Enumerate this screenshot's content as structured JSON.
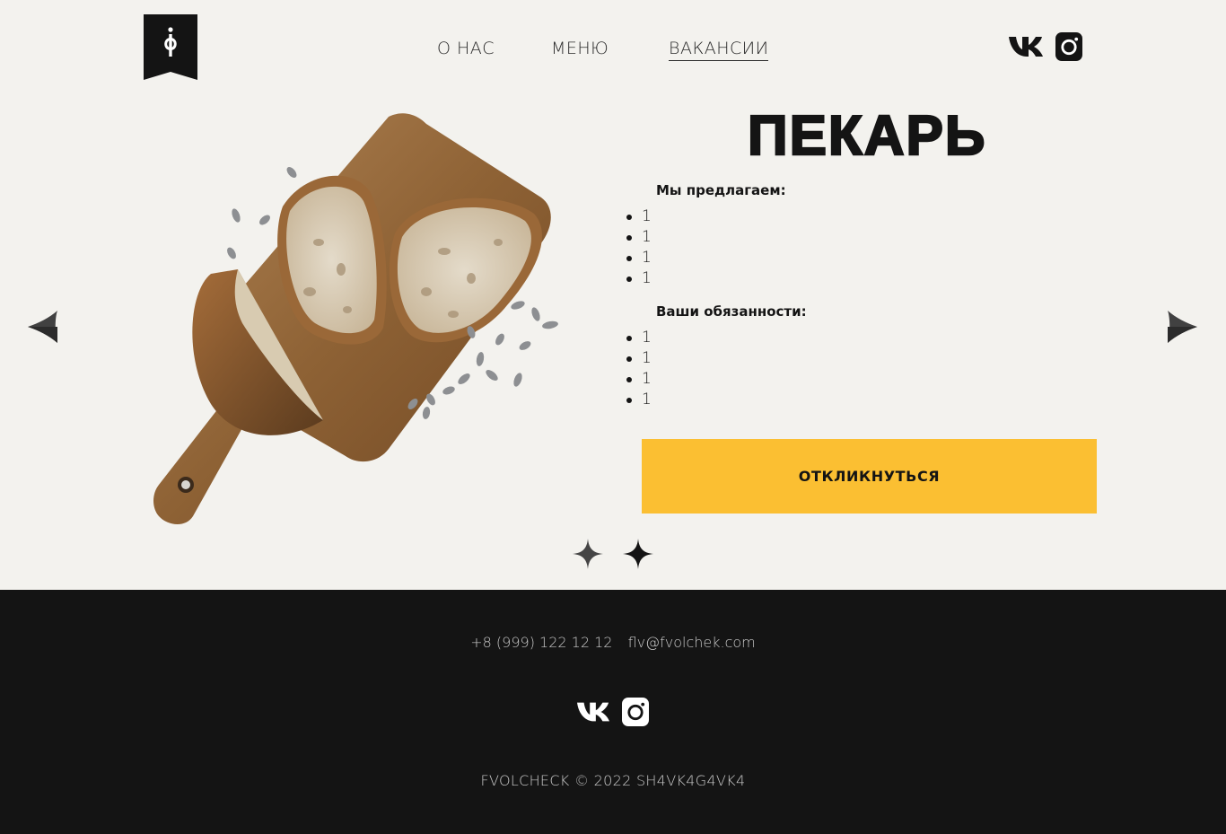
{
  "header": {
    "logo_icon": "bookmark-ef-logo",
    "nav": {
      "about": "О НАС",
      "menu": "МЕНЮ",
      "vacancies": "ВАКАНСИИ"
    },
    "social": [
      "vk-icon",
      "instagram-icon"
    ]
  },
  "slider": {
    "prev_icon": "arrow-left-icon",
    "next_icon": "arrow-right-icon",
    "image": "bread-on-cutting-board",
    "dots_count": 2,
    "active_dot": 2
  },
  "vacancy": {
    "title": "ПЕКАРЬ",
    "offer_heading": "Мы предлагаем:",
    "offer_items": [
      "1",
      "1",
      "1",
      "1"
    ],
    "duties_heading": "Ваши обязанности:",
    "duties_items": [
      "1",
      "1",
      "1",
      "1"
    ],
    "apply_label": "ОТКЛИКНУТЬСЯ"
  },
  "footer": {
    "phone": "+8 (999) 122 12 12",
    "email": "flv@fvolchek.com",
    "social": [
      "vk-icon",
      "instagram-icon"
    ],
    "copyright": "FVOLCHECK © 2022 SH4VK4G4VK4"
  },
  "colors": {
    "background": "#f3f2ee",
    "accent": "#fbbf32",
    "dark": "#141414",
    "footer_text": "#c9c9c9"
  }
}
